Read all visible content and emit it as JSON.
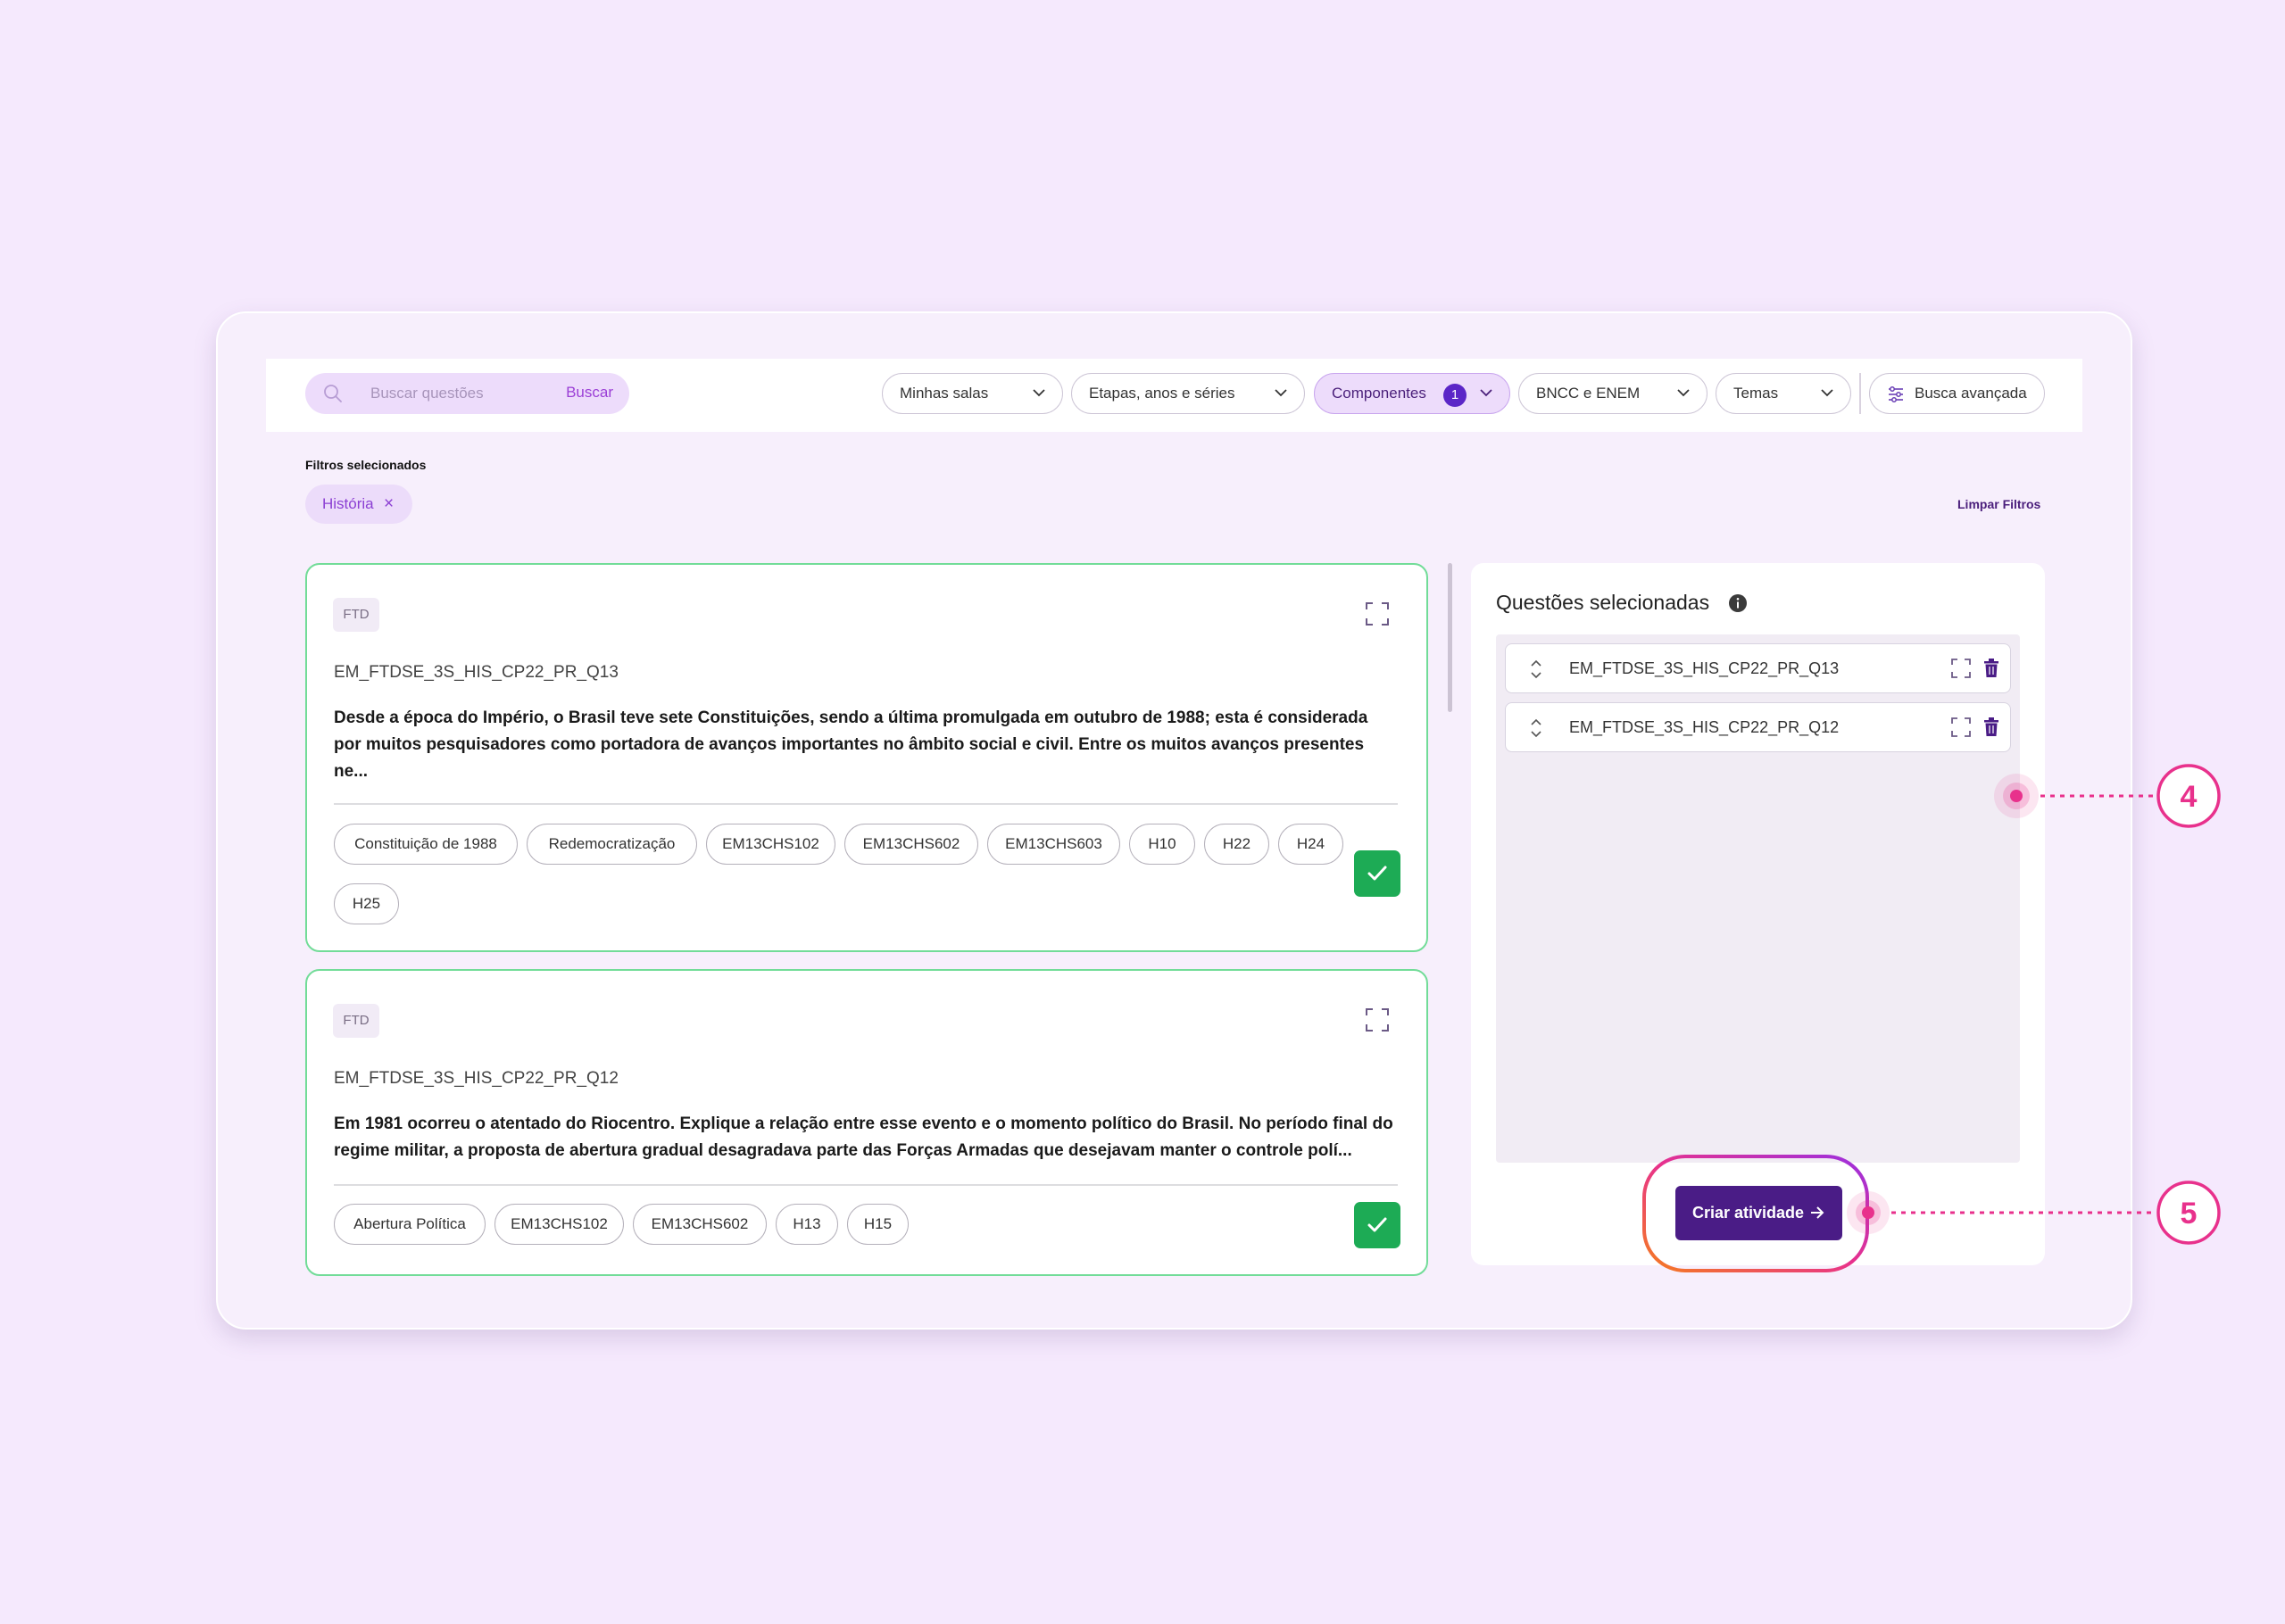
{
  "search": {
    "placeholder": "Buscar questões",
    "button_label": "Buscar"
  },
  "filters_bar": {
    "dropdowns": [
      {
        "label": "Minhas salas"
      },
      {
        "label": "Etapas, anos e séries"
      },
      {
        "label": "Componentes",
        "badge": "1",
        "active": true
      },
      {
        "label": "BNCC e ENEM"
      },
      {
        "label": "Temas"
      }
    ],
    "advanced_search_label": "Busca avançada"
  },
  "selected_filters": {
    "title": "Filtros selecionados",
    "chips": [
      {
        "label": "História"
      }
    ],
    "clear_label": "Limpar Filtros"
  },
  "questions": [
    {
      "source": "FTD",
      "id": "EM_FTDSE_3S_HIS_CP22_PR_Q13",
      "text": "Desde a época do Império, o Brasil teve sete Constituições, sendo a última promulgada em outubro de 1988; esta é considerada por muitos pesquisadores como portadora de avanços importantes no âmbito social e civil. Entre os muitos avanços presentes ne...",
      "tags": [
        "Constituição de 1988",
        "Redemocratização",
        "EM13CHS102",
        "EM13CHS602",
        "EM13CHS603",
        "H10",
        "H22",
        "H24",
        "H25"
      ],
      "selected": true
    },
    {
      "source": "FTD",
      "id": "EM_FTDSE_3S_HIS_CP22_PR_Q12",
      "text": "Em 1981 ocorreu o atentado do Riocentro. Explique a relação entre esse evento e o momento político do Brasil. No período final do regime militar, a proposta de abertura gradual desagradava parte das Forças Armadas que desejavam manter o controle polí...",
      "tags": [
        "Abertura Política",
        "EM13CHS102",
        "EM13CHS602",
        "H13",
        "H15"
      ],
      "selected": true
    }
  ],
  "selected_panel": {
    "title": "Questões selecionadas",
    "items": [
      {
        "label": "EM_FTDSE_3S_HIS_CP22_PR_Q13"
      },
      {
        "label": "EM_FTDSE_3S_HIS_CP22_PR_Q12"
      }
    ],
    "create_label": "Criar atividade"
  },
  "callouts": [
    {
      "number": "4"
    },
    {
      "number": "5"
    }
  ],
  "colors": {
    "background": "#f5e9fd",
    "accent_purple": "#4a1c86",
    "badge_purple": "#5b26c7",
    "selected_green": "#1dab55",
    "card_border_green": "#72dc98",
    "callout_pink": "#e8318c",
    "callout_orange": "#f57c1f"
  },
  "icons": [
    "search-icon",
    "chevron-down-icon",
    "sliders-icon",
    "close-icon",
    "expand-icon",
    "check-icon",
    "info-icon",
    "sort-handle-icon",
    "trash-icon",
    "arrow-right-icon"
  ]
}
